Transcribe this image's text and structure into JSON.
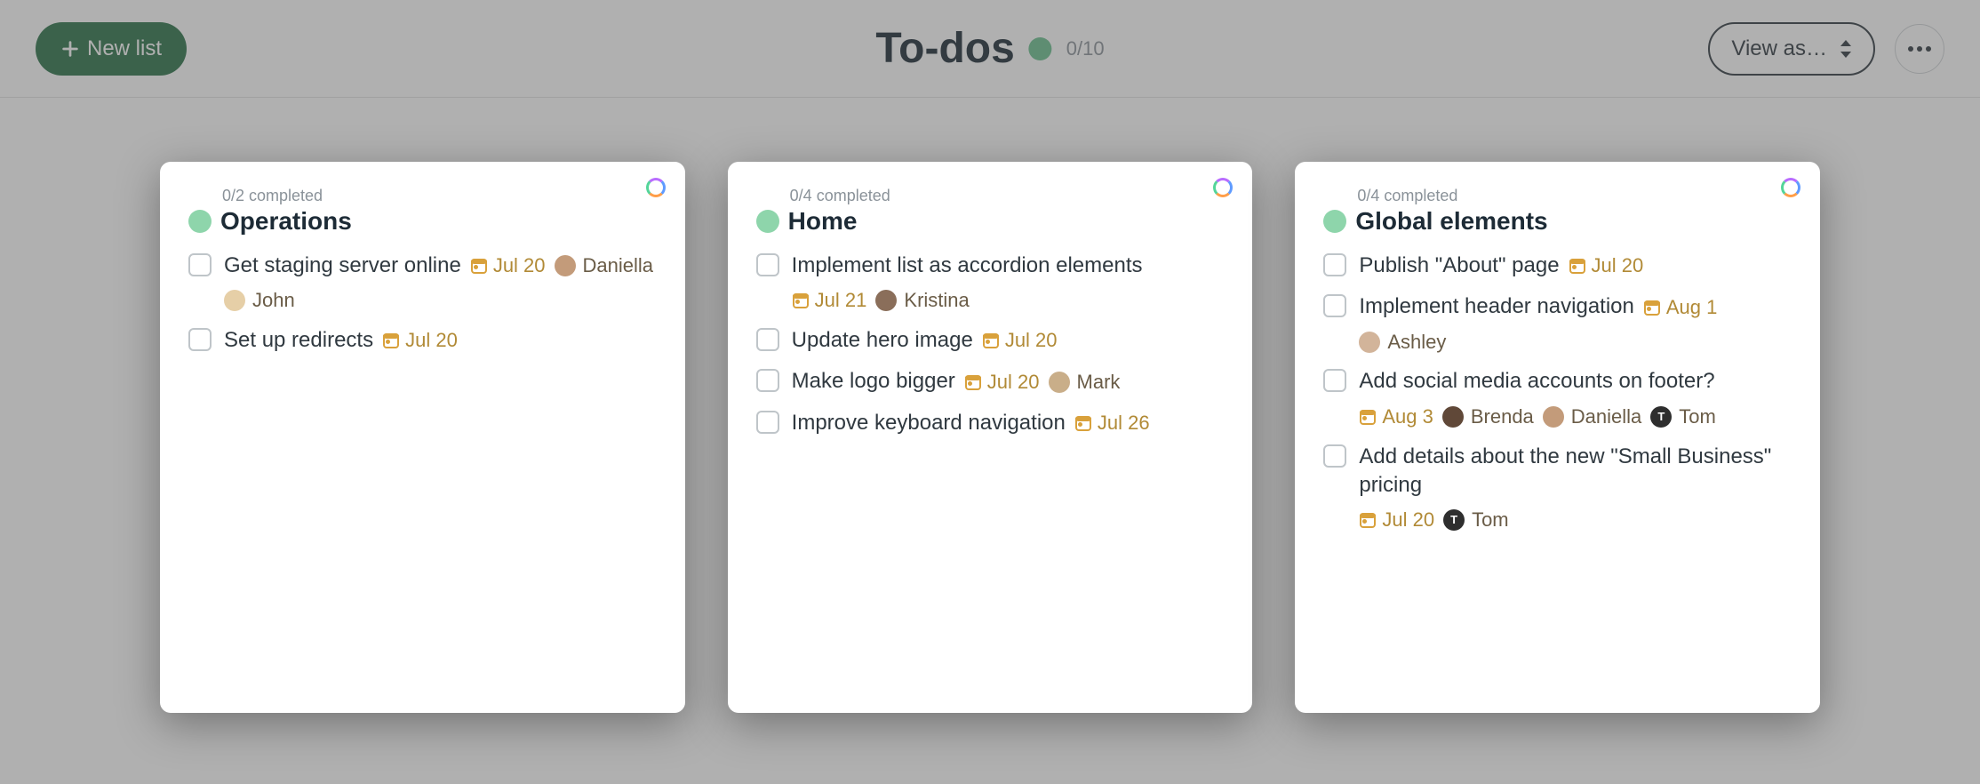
{
  "toolbar": {
    "new_list_label": "New list",
    "view_label": "View as…"
  },
  "header": {
    "title": "To-dos",
    "counter": "0/10"
  },
  "lists": [
    {
      "meta": "0/2 completed",
      "title": "Operations",
      "tasks": [
        {
          "text": "Get staging server online",
          "date": "Jul 20",
          "assignees": [
            {
              "name": "Daniella",
              "avatar_class": "av-daniella"
            },
            {
              "name": "John",
              "avatar_class": "av-john"
            }
          ]
        },
        {
          "text": "Set up redirects",
          "date": "Jul 20",
          "assignees": []
        }
      ]
    },
    {
      "meta": "0/4 completed",
      "title": "Home",
      "tasks": [
        {
          "text": "Implement list as accordion elements",
          "date": "Jul 21",
          "assignees": [
            {
              "name": "Kristina",
              "avatar_class": "av-kristina"
            }
          ]
        },
        {
          "text": "Update hero image",
          "date": "Jul 20",
          "assignees": []
        },
        {
          "text": "Make logo bigger",
          "date": "Jul 20",
          "assignees": [
            {
              "name": "Mark",
              "avatar_class": "av-mark"
            }
          ]
        },
        {
          "text": "Improve keyboard navigation",
          "date": "Jul 26",
          "assignees": []
        }
      ]
    },
    {
      "meta": "0/4 completed",
      "title": "Global elements",
      "tasks": [
        {
          "text": "Publish \"About\" page",
          "date": "Jul 20",
          "assignees": []
        },
        {
          "text": "Implement header navigation",
          "date": "Aug 1",
          "assignees": [
            {
              "name": "Ashley",
              "avatar_class": "av-ashley"
            }
          ]
        },
        {
          "text": "Add social media accounts on footer?",
          "date": "Aug 3",
          "assignees": [
            {
              "name": "Brenda",
              "avatar_class": "av-brenda"
            },
            {
              "name": "Daniella",
              "avatar_class": "av-daniella"
            },
            {
              "name": "Tom",
              "avatar_class": "av-tom",
              "initial": "T"
            }
          ]
        },
        {
          "text": "Add details about the new \"Small Business\" pricing",
          "date": "Jul 20",
          "assignees": [
            {
              "name": "Tom",
              "avatar_class": "av-tom",
              "initial": "T"
            }
          ]
        }
      ]
    }
  ]
}
